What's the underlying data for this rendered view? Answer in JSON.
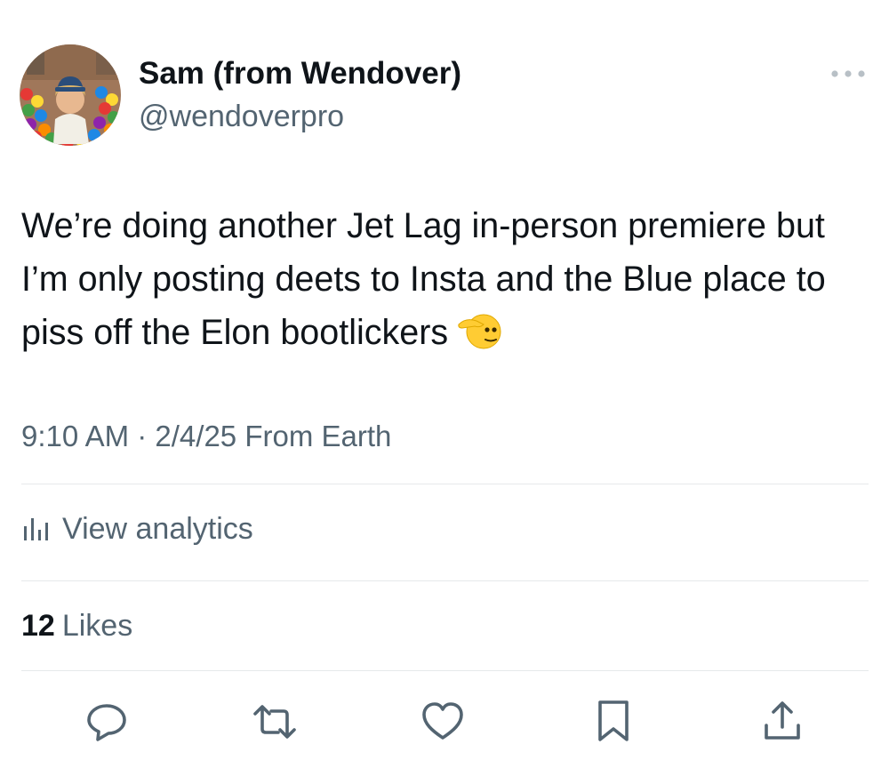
{
  "author": {
    "display_name": "Sam (from Wendover)",
    "handle": "@wendoverpro"
  },
  "tweet": {
    "text": "We’re doing another Jet Lag in-person premiere but I’m only posting deets to Insta and the Blue place to piss off the Elon bootlickers",
    "emoji": "saluting-face",
    "timestamp": "9:10 AM · 2/4/25 From Earth"
  },
  "analytics": {
    "label": "View analytics"
  },
  "engagement": {
    "likes_count": "12",
    "likes_label": "Likes"
  },
  "actions": [
    "reply-icon",
    "retweet-icon",
    "like-icon",
    "bookmark-icon",
    "share-icon"
  ],
  "colors": {
    "text_primary": "#0f1419",
    "text_secondary": "#536471",
    "divider": "#e6e9eb"
  }
}
